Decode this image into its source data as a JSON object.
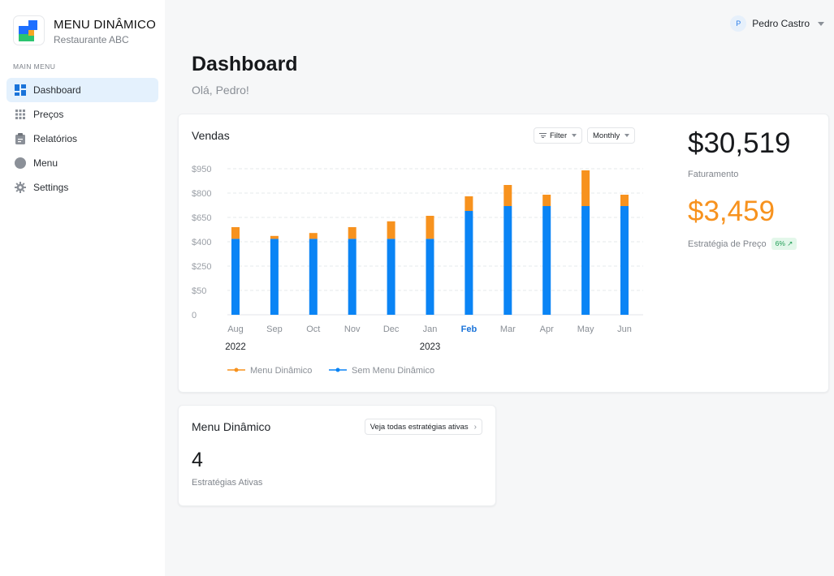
{
  "brand": {
    "title": "MENU DINÂMICO",
    "subtitle": "Restaurante ABC"
  },
  "sidebar": {
    "section_label": "MAIN MENU",
    "items": [
      {
        "label": "Dashboard",
        "icon": "dashboard-icon",
        "active": true
      },
      {
        "label": "Preços",
        "icon": "grid-icon",
        "active": false
      },
      {
        "label": "Relatórios",
        "icon": "clipboard-icon",
        "active": false
      },
      {
        "label": "Menu",
        "icon": "circle-icon",
        "active": false
      },
      {
        "label": "Settings",
        "icon": "gear-icon",
        "active": false
      }
    ]
  },
  "user": {
    "initial": "P",
    "name": "Pedro Castro"
  },
  "page": {
    "title": "Dashboard",
    "greeting": "Olá, Pedro!"
  },
  "sales": {
    "title": "Vendas",
    "filter_label": "Filter",
    "period_label": "Monthly",
    "revenue_value": "$30,519",
    "revenue_label": "Faturamento",
    "strategy_value": "$3,459",
    "strategy_label": "Estratégia de Preço",
    "strategy_badge": "6% ↗"
  },
  "colors": {
    "orange": "#f7921e",
    "blue": "#0a84f5",
    "highlight": "#1a73d9"
  },
  "chart_data": {
    "type": "bar",
    "stacked": true,
    "categories": [
      "Aug",
      "Sep",
      "Oct",
      "Nov",
      "Dec",
      "Jan",
      "Feb",
      "Mar",
      "Apr",
      "May",
      "Jun"
    ],
    "year_labels": [
      {
        "label": "2022",
        "category": "Aug"
      },
      {
        "label": "2023",
        "category": "Jan"
      }
    ],
    "highlighted_category": "Feb",
    "y_ticks": [
      0,
      50,
      250,
      400,
      650,
      800,
      950
    ],
    "y_tick_labels": [
      "0",
      "$50",
      "$250",
      "$400",
      "$650",
      "$800",
      "$950"
    ],
    "series": [
      {
        "name": "Sem Menu Dinâmico",
        "color": "#0a84f5",
        "values": [
          430,
          430,
          430,
          430,
          430,
          430,
          690,
          720,
          720,
          720,
          720
        ]
      },
      {
        "name": "Menu Dinâmico",
        "color": "#f7921e",
        "values": [
          120,
          30,
          60,
          120,
          180,
          230,
          90,
          130,
          70,
          220,
          70
        ]
      }
    ],
    "grid": true,
    "legend": "bottom-left"
  },
  "menu_card": {
    "title": "Menu Dinâmico",
    "button_label": "Veja todas estratégias ativas",
    "count": "4",
    "count_label": "Estratégias Ativas"
  }
}
